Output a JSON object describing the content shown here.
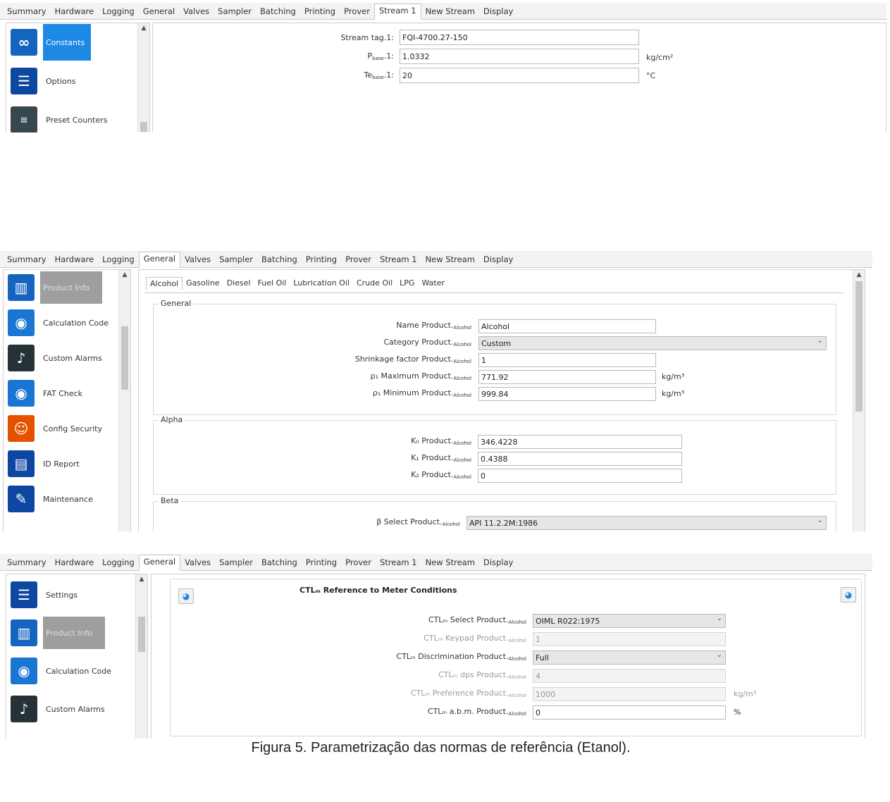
{
  "tabs": [
    "Summary",
    "Hardware",
    "Logging",
    "General",
    "Valves",
    "Sampler",
    "Batching",
    "Printing",
    "Prover",
    "Stream 1",
    "New Stream",
    "Display"
  ],
  "panel1": {
    "active_tab": "Stream 1",
    "sidebar": [
      {
        "label": "Constants",
        "icon": "constants-icon",
        "color": "#1565c0"
      },
      {
        "label": "Options",
        "icon": "options-sliders-icon",
        "color": "#0d47a1"
      },
      {
        "label": "Preset Counters",
        "icon": "preset-counters-icon",
        "color": "#37474f"
      }
    ],
    "fields": [
      {
        "label": "Stream tag.1:",
        "value": "FQI-4700.27-150",
        "unit": ""
      },
      {
        "label": "P",
        "sub": "base",
        "suffix": ".1:",
        "value": "1.0332",
        "unit": "kg/cm²"
      },
      {
        "label": "Te",
        "sub": "base",
        "suffix": ".1:",
        "value": "20",
        "unit": "°C"
      }
    ]
  },
  "panel2": {
    "active_tab": "General",
    "sidebar": [
      {
        "label": "Product Info",
        "icon": "product-info-icon"
      },
      {
        "label": "Calculation Code",
        "icon": "calculation-code-icon"
      },
      {
        "label": "Custom Alarms",
        "icon": "custom-alarms-bell-icon"
      },
      {
        "label": "FAT Check",
        "icon": "fat-check-icon"
      },
      {
        "label": "Config Security",
        "icon": "config-security-users-icon"
      },
      {
        "label": "ID Report",
        "icon": "id-report-document-icon"
      },
      {
        "label": "Maintenance",
        "icon": "maintenance-wrench-icon"
      }
    ],
    "product_tabs": [
      "Alcohol",
      "Gasoline",
      "Diesel",
      "Fuel Oil",
      "Lubrication Oil",
      "Crude Oil",
      "LPG",
      "Water"
    ],
    "active_product_tab": "Alcohol",
    "general_title": "General",
    "general_fields": [
      {
        "label": "Name Product.",
        "sub": "Alcohol",
        "value": "Alcohol",
        "unit": ""
      },
      {
        "label": "Category Product.",
        "sub": "Alcohol",
        "value": "Custom",
        "unit": ""
      },
      {
        "label": "Shrinkage factor Product.",
        "sub": "Alcohol",
        "value": "1",
        "unit": ""
      },
      {
        "label": "ρ₁ Maximum Product.",
        "sub": "Alcohol",
        "value": "771.92",
        "unit": "kg/m³"
      },
      {
        "label": "ρ₁ Minimum Product.",
        "sub": "Alcohol",
        "value": "999.84",
        "unit": "kg/m³"
      }
    ],
    "alpha_title": "Alpha",
    "alpha_fields": [
      {
        "label": "K₀ Product.",
        "sub": "Alcohol",
        "value": "346.4228"
      },
      {
        "label": "K₁ Product.",
        "sub": "Alcohol",
        "value": "0.4388"
      },
      {
        "label": "K₂ Product.",
        "sub": "Alcohol",
        "value": "0"
      }
    ],
    "beta_title": "Beta",
    "beta_fields": [
      {
        "label": "β Select Product.",
        "sub": "Alcohol",
        "value": "API 11.2.2M:1986"
      }
    ]
  },
  "panel3": {
    "active_tab": "General",
    "sidebar": [
      {
        "label": "Settings",
        "icon": "settings-sliders-icon"
      },
      {
        "label": "Product Info",
        "icon": "product-info-icon"
      },
      {
        "label": "Calculation Code",
        "icon": "calculation-code-icon"
      },
      {
        "label": "Custom Alarms",
        "icon": "custom-alarms-bell-icon"
      }
    ],
    "section_title": "CTLₘ Reference to Meter Conditions",
    "fields": [
      {
        "label": "CTLₘ Select Product.",
        "sub": "Alcohol",
        "value": "OIML R022:1975",
        "unit": "",
        "state": "dropdown"
      },
      {
        "label": "CTLₘ Keypad Product.",
        "sub": "Alcohol",
        "value": "1",
        "unit": "",
        "state": "disabled"
      },
      {
        "label": "CTLₘ Discrimination Product.",
        "sub": "Alcohol",
        "value": "Full",
        "unit": "",
        "state": "dropdown"
      },
      {
        "label": "CTLₘ dps Product.",
        "sub": "Alcohol",
        "value": "4",
        "unit": "",
        "state": "disabled"
      },
      {
        "label": "CTLₘ Preference Product.",
        "sub": "Alcohol",
        "value": "1000",
        "unit": "kg/m³",
        "state": "disabled"
      },
      {
        "label": "CTLₘ a.b.m. Product.",
        "sub": "Alcohol",
        "value": "0",
        "unit": "%",
        "state": "normal"
      }
    ]
  },
  "caption": "Figura 5. Parametrização das normas de referência (Etanol)."
}
